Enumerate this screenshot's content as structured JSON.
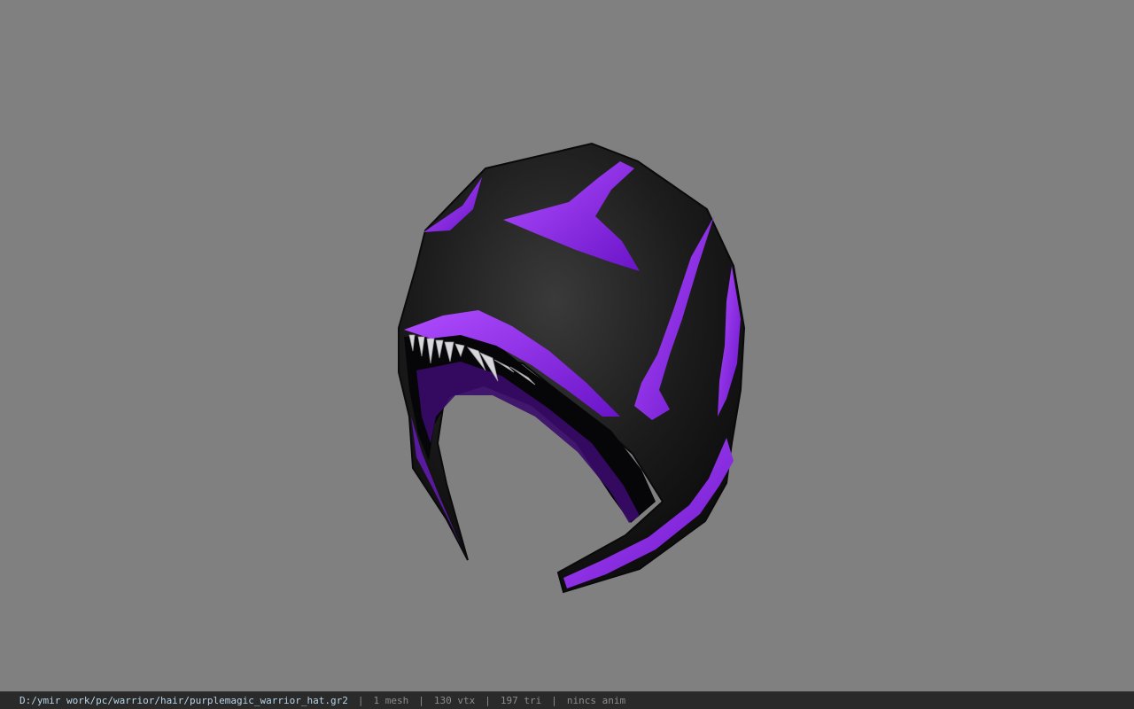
{
  "viewport": {
    "model": "hood-helmet-3d-model",
    "background_color": "#808080",
    "accent_color": "#8a2be2"
  },
  "statusbar": {
    "file_path": "D:/ymir work/pc/warrior/hair/purplemagic_warrior_hat.gr2",
    "separator": "|",
    "mesh_count": "1 mesh",
    "vertex_count": "130 vtx",
    "triangle_count": "197 tri",
    "anim_status": "nincs anim"
  }
}
